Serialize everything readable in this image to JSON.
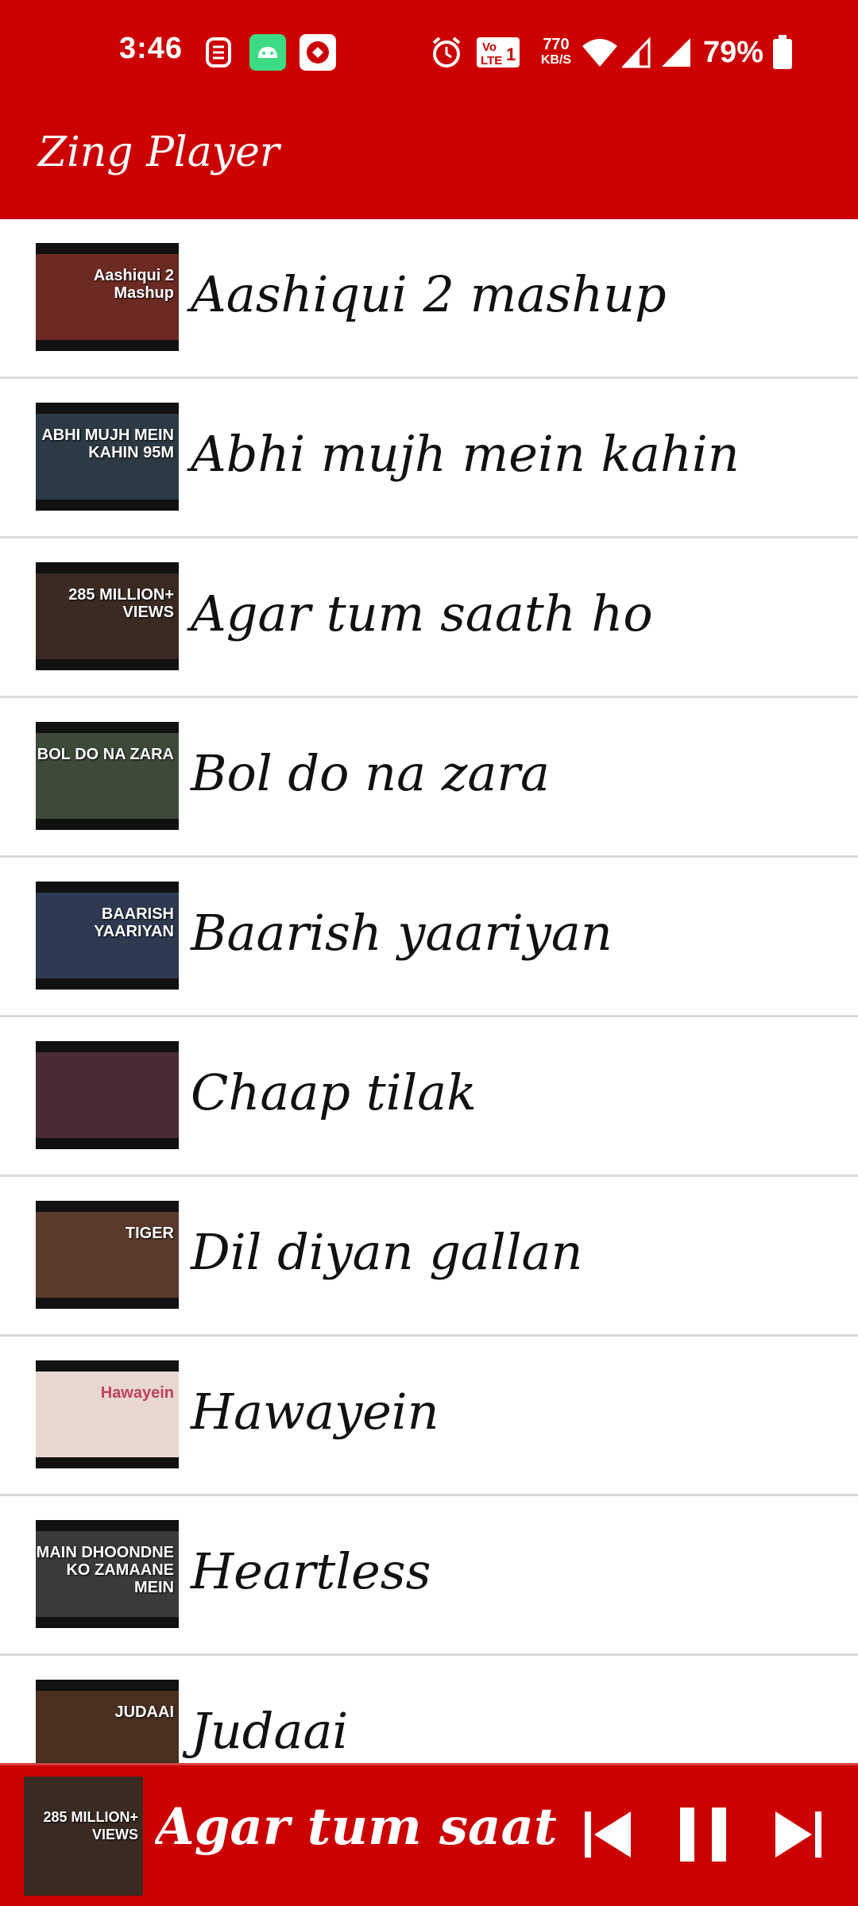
{
  "status_bar": {
    "time": "3:46",
    "network_speed_value": "770",
    "network_speed_unit": "KB/S",
    "volte_label": "Vo LTE 1",
    "battery": "79%",
    "icons": [
      "s-icon",
      "android-icon",
      "app-notification-icon",
      "alarm-icon",
      "volte-icon",
      "wifi-icon",
      "signal-icon",
      "signal-icon-2",
      "battery-icon"
    ]
  },
  "app_bar": {
    "title": "Zing Player"
  },
  "songs": [
    {
      "title": "Aashiqui 2 mashup",
      "thumb_color": "#6b2a22",
      "thumb_caption": "Aashiqui 2 Mashup"
    },
    {
      "title": "Abhi mujh mein kahin",
      "thumb_color": "#2b3a44",
      "thumb_caption": "ABHI MUJH MEIN KAHIN 95M"
    },
    {
      "title": "Agar tum saath ho",
      "thumb_color": "#3a2a22",
      "thumb_caption": "285 MILLION+ VIEWS"
    },
    {
      "title": "Bol do na zara",
      "thumb_color": "#3d4a3a",
      "thumb_caption": "BOL DO NA ZARA"
    },
    {
      "title": "Baarish yaariyan",
      "thumb_color": "#2e3a52",
      "thumb_caption": "BAARISH YAARIYAN"
    },
    {
      "title": "Chaap tilak",
      "thumb_color": "#4a2a34",
      "thumb_caption": ""
    },
    {
      "title": "Dil diyan gallan",
      "thumb_color": "#5a3a2a",
      "thumb_caption": "TIGER"
    },
    {
      "title": "Hawayein",
      "thumb_color": "#e8d8d0",
      "thumb_caption": "Hawayein"
    },
    {
      "title": "Heartless",
      "thumb_color": "#3a3a3a",
      "thumb_caption": "MAIN DHOONDNE KO ZAMAANE MEIN"
    },
    {
      "title": "Judaai",
      "thumb_color": "#4a3020",
      "thumb_caption": "JUDAAI"
    }
  ],
  "mini_player": {
    "title": "Agar tum saath h",
    "thumb_caption": "285 MILLION+ VIEWS",
    "controls": [
      "previous-icon",
      "pause-icon",
      "next-icon"
    ]
  },
  "colors": {
    "primary": "#cc0000",
    "divider": "#dadada",
    "text": "#111111"
  }
}
